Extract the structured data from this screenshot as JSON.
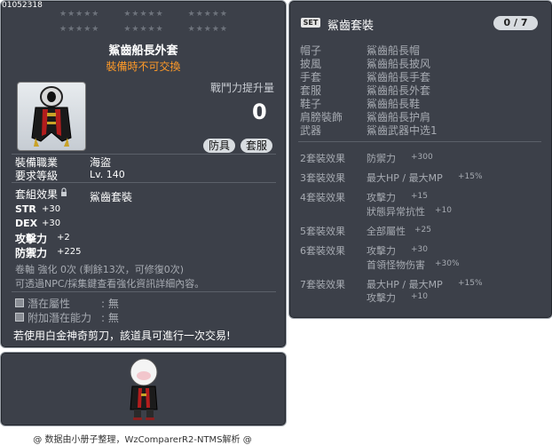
{
  "item_id": "01052318",
  "item": {
    "title": "鯊齒船長外套",
    "untradable": "裝備時不可交換",
    "atk_increase_label": "戰鬥力提升量",
    "atk_increase_value": "0",
    "tags": [
      "防具",
      "套服"
    ],
    "job_label": "裝備職業",
    "job_value": "海盜",
    "level_label": "要求等級",
    "level_value": "Lv. 140",
    "set_label": "套組效果",
    "set_value": "鯊齒套裝",
    "stats": [
      {
        "name": "STR",
        "value": "+30"
      },
      {
        "name": "DEX",
        "value": "+30"
      },
      {
        "name": "攻擊力",
        "value": "+2"
      },
      {
        "name": "防禦力",
        "value": "+225"
      }
    ],
    "scroll_line": "卷軸 強化 0次 (剩餘13次，可修復0次)",
    "npc_line": "可透過NPC/採集鍵查看強化資訊詳細內容。",
    "potential_label": "潛在屬性",
    "potential_value": ": 無",
    "add_potential_label": "附加潛在能力",
    "add_potential_value": ": 無",
    "platinum_note": "若使用白金神奇剪刀，該道具可進行一次交易!"
  },
  "set": {
    "badge": "SET",
    "title": "鯊齒套裝",
    "count": "0 / 7",
    "parts": [
      {
        "slot": "帽子",
        "name": "鯊齒船長帽"
      },
      {
        "slot": "披風",
        "name": "鯊齒船長披风"
      },
      {
        "slot": "手套",
        "name": "鯊齒船長手套"
      },
      {
        "slot": "套服",
        "name": "鯊齒船長外套"
      },
      {
        "slot": "鞋子",
        "name": "鯊齒船長鞋"
      },
      {
        "slot": "肩膀裝飾",
        "name": "鯊齒船長护肩"
      },
      {
        "slot": "武器",
        "name": "鯊齒武器中选1"
      }
    ],
    "effects": [
      {
        "label": "2套裝效果",
        "lines": [
          {
            "name": "防禦力",
            "value": "+300"
          }
        ]
      },
      {
        "label": "3套裝效果",
        "lines": [
          {
            "name": "最大HP / 最大MP",
            "value": "+15%"
          }
        ]
      },
      {
        "label": "4套裝效果",
        "lines": [
          {
            "name": "攻擊力",
            "value": "+15"
          },
          {
            "name": "狀態异常抗性",
            "value": "+10"
          }
        ]
      },
      {
        "label": "5套裝效果",
        "lines": [
          {
            "name": "全部屬性",
            "value": "+25"
          }
        ]
      },
      {
        "label": "6套裝效果",
        "lines": [
          {
            "name": "攻擊力",
            "value": "+30"
          },
          {
            "name": "首領怪物伤害",
            "value": "+30%"
          }
        ]
      },
      {
        "label": "7套裝效果",
        "lines": [
          {
            "name": "最大HP / 最大MP",
            "value": "+15%"
          },
          {
            "name": "攻擊力",
            "value": "+10"
          }
        ]
      }
    ]
  },
  "stars": {
    "group": "★★★★★"
  },
  "icons": {
    "lock": "lock-icon",
    "check": "checkbox-icon",
    "set": "set-badge"
  },
  "colors": {
    "panel": "#3c4049",
    "untradable": "#ff9a28",
    "muted": "#a7abb2"
  },
  "credits": "@ 数据由小册子整理，WzComparerR2-NTMS解析 @"
}
